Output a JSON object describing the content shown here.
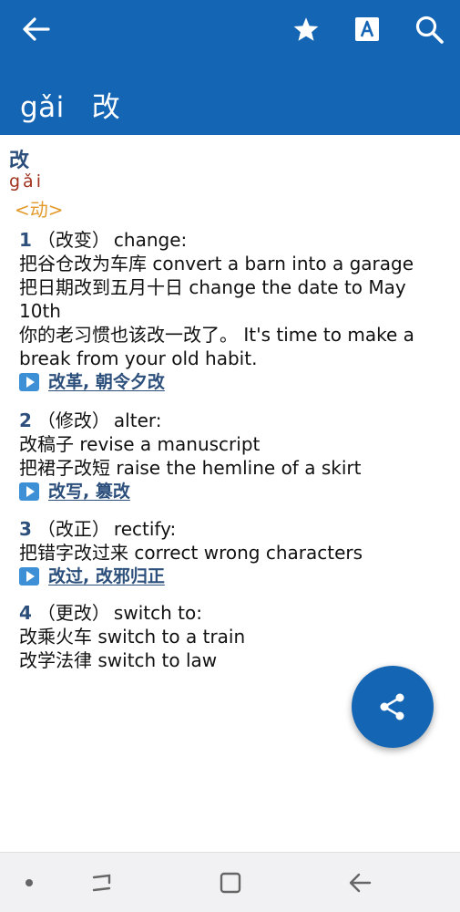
{
  "header": {
    "pinyin": "gǎi",
    "character": "改"
  },
  "entry": {
    "headword": "改",
    "pinyin": "gǎi",
    "part_of_speech": "<动>"
  },
  "senses": [
    {
      "number": "1",
      "label": "（改变）",
      "gloss": "change:",
      "examples": [
        "把谷仓改为车库 convert a barn into a garage",
        "把日期改到五月十日 change the date to May 10th",
        "你的老习惯也该改一改了。 It's time to make a break from your old habit."
      ],
      "links": "改革, 朝令夕改"
    },
    {
      "number": "2",
      "label": "（修改）",
      "gloss": "alter:",
      "examples": [
        "改稿子 revise a manuscript",
        "把裙子改短 raise the hemline of a skirt"
      ],
      "links": "改写, 篡改"
    },
    {
      "number": "3",
      "label": "（改正）",
      "gloss": "rectify:",
      "examples": [
        "把错字改过来 correct wrong characters"
      ],
      "links": "改过, 改邪归正"
    },
    {
      "number": "4",
      "label": "（更改）",
      "gloss": "switch to:",
      "examples": [
        "改乘火车 switch to a train",
        "改学法律 switch to law"
      ]
    }
  ],
  "icons": {
    "back": "arrow-left-icon",
    "favorite": "star-icon",
    "font": "font-size-icon",
    "search": "search-icon",
    "share": "share-icon"
  },
  "colors": {
    "primary": "#1565b5",
    "headword": "#2c4f7c",
    "pinyin": "#a0321e",
    "part_of_speech": "#e29a2b",
    "link_play": "#3d8fd6"
  }
}
